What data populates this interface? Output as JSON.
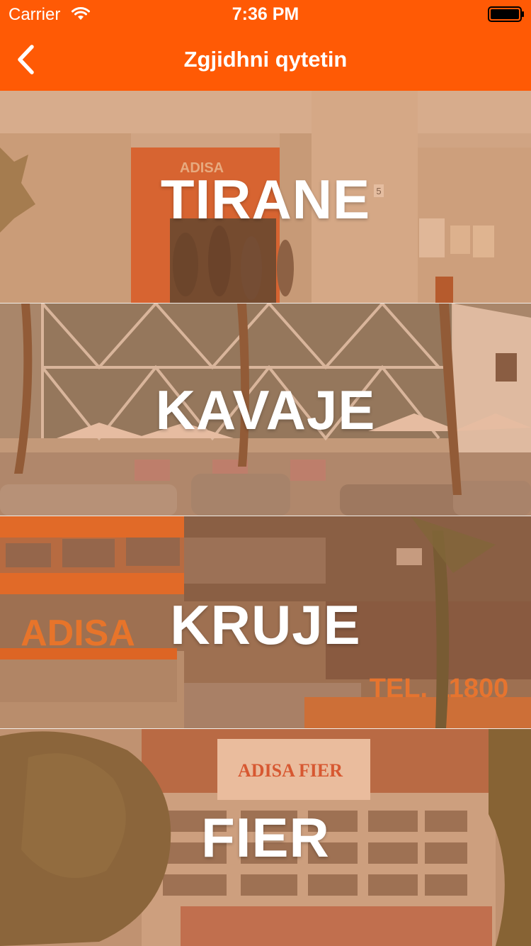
{
  "status_bar": {
    "carrier": "Carrier",
    "time": "7:36 PM"
  },
  "nav": {
    "title": "Zgjidhni qytetin",
    "back_icon": "chevron-left-icon"
  },
  "colors": {
    "accent": "#ff5a05",
    "overlay": "#d6783c",
    "label": "#ffffff"
  },
  "cities": [
    {
      "name": "TIRANE"
    },
    {
      "name": "KAVAJE",
      "signage": []
    },
    {
      "name": "KRUJE",
      "signage": [
        "ADISA",
        "TEL. 11800"
      ]
    },
    {
      "name": "FIER",
      "signage": [
        "ADISA FIER"
      ]
    }
  ],
  "photo_signs": {
    "tirane_door": "ADISA",
    "tirane_number": "5",
    "kruje_logo": "ADISA",
    "kruje_tel": "TEL. 11800",
    "fier_sign": "ADISA FIER"
  }
}
